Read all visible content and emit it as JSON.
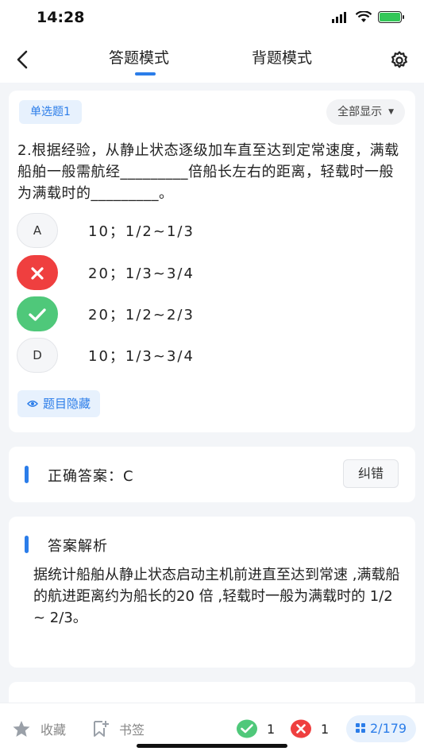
{
  "status": {
    "time": "14:28"
  },
  "header": {
    "tabs": [
      "答题模式",
      "背题模式"
    ],
    "active_tab": 0
  },
  "question": {
    "type_label": "单选题1",
    "filter_label": "全部显示",
    "text": "2.根据经验，从静止状态逐级加车直至达到定常速度，满载船舶一般需航经_________倍船长左右的距离，轻载时一般为满载时的_________。",
    "options": [
      {
        "key": "A",
        "text": "10；1/2~1/3",
        "state": "normal"
      },
      {
        "key": "B",
        "text": "20；1/3~3/4",
        "state": "wrong"
      },
      {
        "key": "C",
        "text": "20；1/2~2/3",
        "state": "right"
      },
      {
        "key": "D",
        "text": "10；1/3~3/4",
        "state": "normal"
      }
    ],
    "hide_label": "题目隐藏"
  },
  "answer": {
    "label": "正确答案：C",
    "correct_button": "纠错"
  },
  "analysis": {
    "title": "答案解析",
    "text": "据统计船舶从静止状态启动主机前进直至达到常速 ,满载船的航进距离约为船长的20 倍 ,轻载时一般为满载时的 1/2 ~ 2/3。"
  },
  "bottom": {
    "favorite_label": "收藏",
    "bookmark_label": "书签",
    "right_count": "1",
    "wrong_count": "1",
    "progress": "2/179"
  },
  "colors": {
    "accent": "#2b7de9",
    "right": "#4fc87a",
    "wrong": "#ef3f3f"
  }
}
